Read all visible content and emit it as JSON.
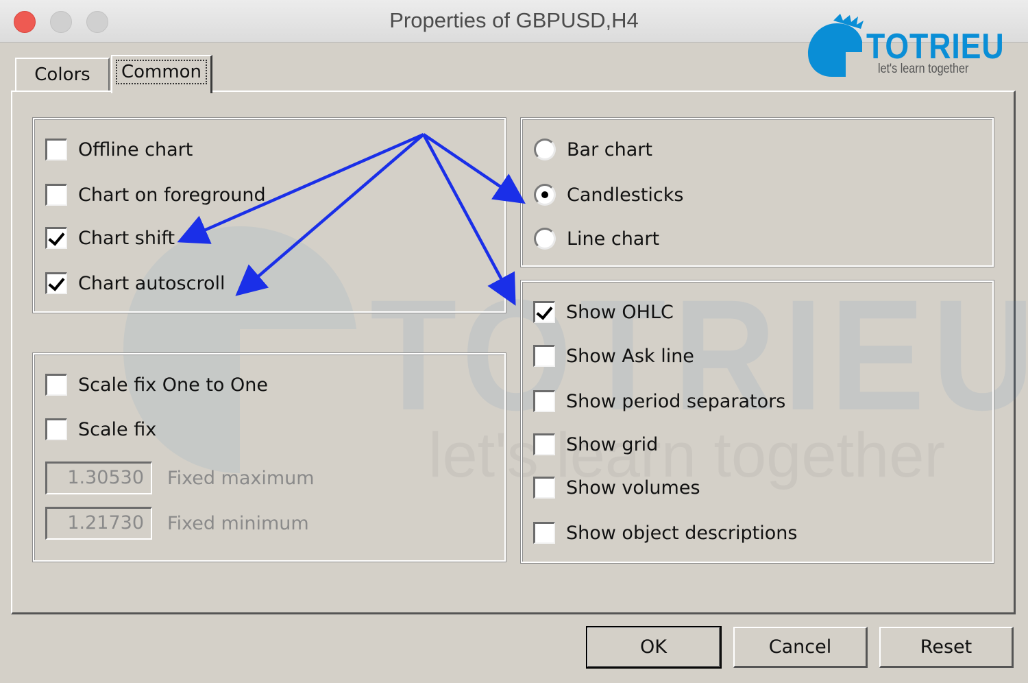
{
  "window": {
    "title": "Properties of GBPUSD,H4"
  },
  "logo": {
    "name": "TOTRIEU",
    "tagline": "let's learn together"
  },
  "tabs": [
    {
      "label": "Colors",
      "active": false
    },
    {
      "label": "Common",
      "active": true
    }
  ],
  "chart_options": [
    {
      "label": "Offline chart",
      "checked": false
    },
    {
      "label": "Chart on foreground",
      "checked": false
    },
    {
      "label": "Chart shift",
      "checked": true
    },
    {
      "label": "Chart autoscroll",
      "checked": true
    }
  ],
  "scale_options": [
    {
      "label": "Scale fix One to One",
      "checked": false
    },
    {
      "label": "Scale fix",
      "checked": false
    }
  ],
  "fixed": {
    "max_value": "1.30530",
    "max_label": "Fixed maximum",
    "min_value": "1.21730",
    "min_label": "Fixed minimum"
  },
  "chart_types": [
    {
      "label": "Bar chart",
      "selected": false
    },
    {
      "label": "Candlesticks",
      "selected": true
    },
    {
      "label": "Line chart",
      "selected": false
    }
  ],
  "display_options": [
    {
      "label": "Show OHLC",
      "checked": true
    },
    {
      "label": "Show Ask line",
      "checked": false
    },
    {
      "label": "Show period separators",
      "checked": false
    },
    {
      "label": "Show grid",
      "checked": false
    },
    {
      "label": "Show volumes",
      "checked": false
    },
    {
      "label": "Show object descriptions",
      "checked": false
    }
  ],
  "buttons": {
    "ok": "OK",
    "cancel": "Cancel",
    "reset": "Reset"
  },
  "colors": {
    "arrow": "#1a2fe8",
    "brand": "#0a8ed6",
    "close_button": "#ee5a52"
  }
}
